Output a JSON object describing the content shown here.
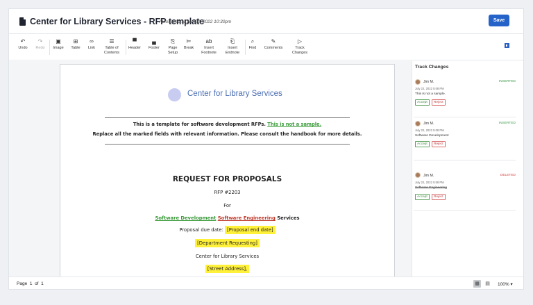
{
  "header": {
    "title": "Center for Library Services - RFP template",
    "autosave": "Autosaved at Jan 20, 2022 10:30pm",
    "save_label": "Save"
  },
  "toolbar": {
    "items": [
      {
        "label": "Undo",
        "icon": "↶",
        "icon_name": "undo-icon",
        "disabled": false
      },
      {
        "label": "Redo",
        "icon": "↷",
        "icon_name": "redo-icon",
        "disabled": true
      },
      {
        "label": "Image",
        "icon": "▣",
        "icon_name": "image-icon",
        "disabled": false
      },
      {
        "label": "Table",
        "icon": "⊞",
        "icon_name": "table-icon",
        "disabled": false
      },
      {
        "label": "Link",
        "icon": "∞",
        "icon_name": "link-icon",
        "disabled": false
      },
      {
        "label": "Table of Contents",
        "icon": "☰",
        "icon_name": "table-of-contents-icon",
        "disabled": false
      },
      {
        "label": "Header",
        "icon": "▀",
        "icon_name": "header-icon",
        "disabled": false
      },
      {
        "label": "Footer",
        "icon": "▄",
        "icon_name": "footer-icon",
        "disabled": false
      },
      {
        "label": "Page Setup",
        "icon": "⎘",
        "icon_name": "page-setup-icon",
        "disabled": false
      },
      {
        "label": "Break",
        "icon": "⊨",
        "icon_name": "break-icon",
        "disabled": false
      },
      {
        "label": "Insert Footnote",
        "icon": "ab",
        "icon_name": "footnote-icon",
        "disabled": false
      },
      {
        "label": "Insert Endnote",
        "icon": "⎗",
        "icon_name": "endnote-icon",
        "disabled": false
      },
      {
        "label": "Find",
        "icon": "⌕",
        "icon_name": "search-icon",
        "disabled": false
      },
      {
        "label": "Comments",
        "icon": "✎",
        "icon_name": "comments-icon",
        "disabled": false
      },
      {
        "label": "Track Changes",
        "icon": "▷",
        "icon_name": "track-changes-icon",
        "disabled": false
      }
    ]
  },
  "document": {
    "logo_text": "Center for Library Services",
    "intro_line1_pre": "This is a template for software development RFPs. ",
    "intro_line1_inserted": "This is not a sample.",
    "intro_line2": "Replace all the marked fields with relevant information. Please consult the handbook for more details.",
    "rfp_title": "REQUEST FOR PROPOSALS",
    "rfp_number": "RFP #2203",
    "for_text": "For",
    "services_inserted": "Software Development",
    "services_deleted": "Software Engineering",
    "services_suffix": "Services",
    "due_date_label": "Proposal due date: ",
    "due_date_value": "[Proposal end date]",
    "department": "[Department Requesting]",
    "org_name": "Center for Library Services",
    "street": "[Street Address],"
  },
  "track_changes": {
    "title": "Track Changes",
    "changes": [
      {
        "author": "Jim M.",
        "status": "INSERTED",
        "date": "July 22, 2022 5:08 PM",
        "text": "This is not a sample.",
        "accept": "Accept",
        "reject": "Reject"
      },
      {
        "author": "Jim M.",
        "status": "INSERTED",
        "date": "July 22, 2022 5:08 PM",
        "text": "Software Development",
        "accept": "Accept",
        "reject": "Reject"
      },
      {
        "author": "Jim M.",
        "status": "DELETED",
        "date": "July 22, 2022 5:08 PM",
        "text": "Software Engineering",
        "accept": "Accept",
        "reject": "Reject"
      }
    ]
  },
  "statusbar": {
    "page_label": "Page",
    "page_current": "1",
    "page_of": "of",
    "page_total": "1",
    "zoom": "100%",
    "zoom_caret": "▾",
    "view_print_icon": "▦",
    "view_web_icon": "▤"
  },
  "colors": {
    "accent": "#2563c9",
    "inserted": "#3a9a3a",
    "deleted": "#c0392b",
    "highlight": "#fff03a"
  }
}
